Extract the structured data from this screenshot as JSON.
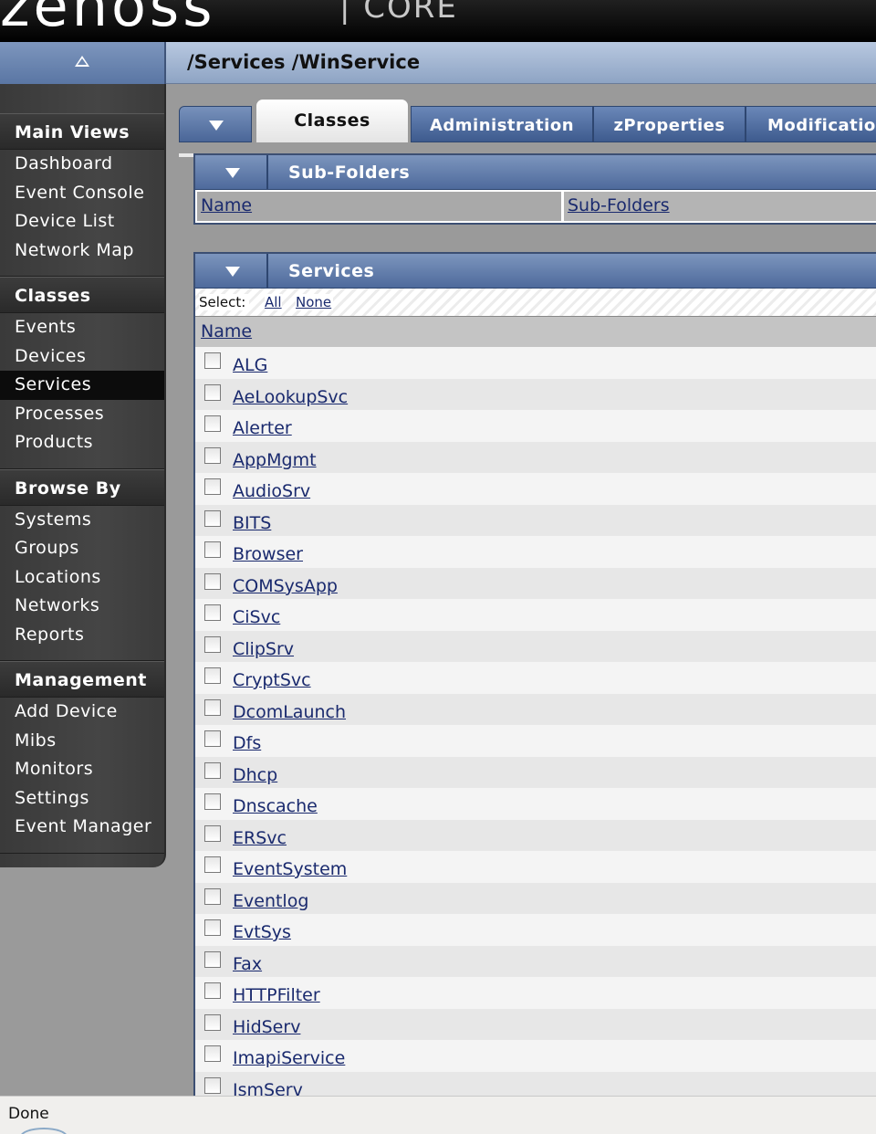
{
  "header": {
    "logo": "zenoss",
    "logo_sub": "| CORE"
  },
  "breadcrumb": "/Services /WinService",
  "sidebar": {
    "sections": [
      {
        "title": "Main Views",
        "items": [
          "Dashboard",
          "Event Console",
          "Device List",
          "Network Map"
        ]
      },
      {
        "title": "Classes",
        "items": [
          "Events",
          "Devices",
          "Services",
          "Processes",
          "Products"
        ]
      },
      {
        "title": "Browse By",
        "items": [
          "Systems",
          "Groups",
          "Locations",
          "Networks",
          "Reports"
        ]
      },
      {
        "title": "Management",
        "items": [
          "Add Device",
          "Mibs",
          "Monitors",
          "Settings",
          "Event Manager"
        ]
      }
    ],
    "active_item": "Services"
  },
  "tabs": [
    "Classes",
    "Administration",
    "zProperties",
    "Modifications"
  ],
  "active_tab": "Classes",
  "subfolders": {
    "title": "Sub-Folders",
    "col_name": "Name",
    "col_subfolders": "Sub-Folders"
  },
  "services": {
    "title": "Services",
    "select_label": "Select:",
    "select_all": "All",
    "select_none": "None",
    "col_name": "Name",
    "items": [
      "ALG",
      "AeLookupSvc",
      "Alerter",
      "AppMgmt",
      "AudioSrv",
      "BITS",
      "Browser",
      "COMSysApp",
      "CiSvc",
      "ClipSrv",
      "CryptSvc",
      "DcomLaunch",
      "Dfs",
      "Dhcp",
      "Dnscache",
      "ERSvc",
      "EventSystem",
      "Eventlog",
      "EvtSys",
      "Fax",
      "HTTPFilter",
      "HidServ",
      "ImapiService",
      "IsmServ"
    ]
  },
  "status": {
    "text": "Done"
  }
}
